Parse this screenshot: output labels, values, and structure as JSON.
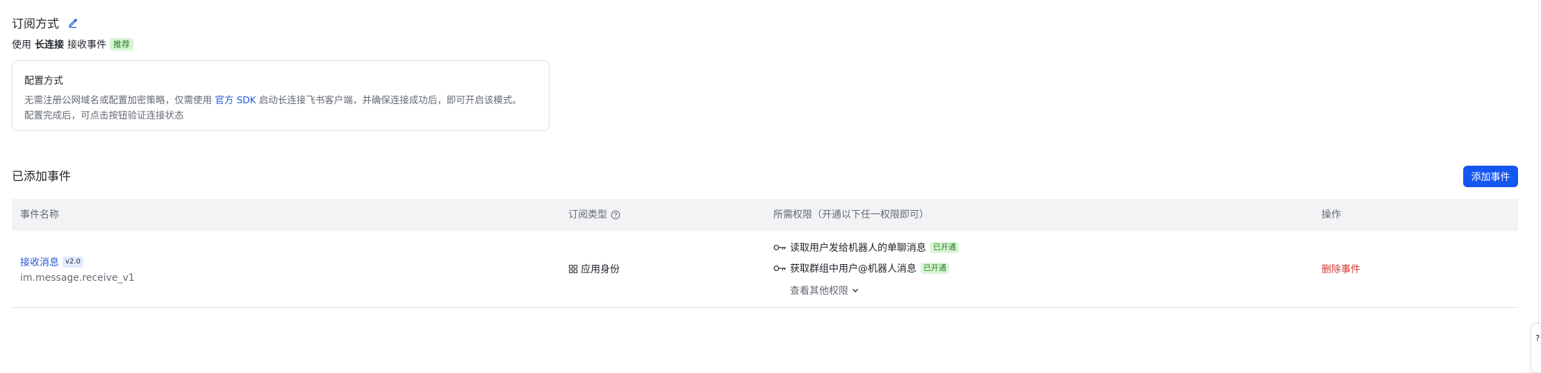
{
  "subscription": {
    "title": "订阅方式",
    "mode_prefix": "使用",
    "mode_bold": "长连接",
    "mode_suffix": "接收事件",
    "recommend_tag": "推荐"
  },
  "config": {
    "title": "配置方式",
    "desc_part1": "无需注册公网域名或配置加密策略，仅需使用 ",
    "desc_link": "官方 SDK",
    "desc_part2": " 启动长连接飞书客户端，并确保连接成功后，即可开启该模式。",
    "desc_line2": "配置完成后，可点击按钮验证连接状态"
  },
  "events": {
    "title": "已添加事件",
    "add_button": "添加事件",
    "columns": [
      "事件名称",
      "订阅类型",
      "所需权限（开通以下任一权限即可）",
      "操作"
    ],
    "rows": [
      {
        "name": "接收消息",
        "version": "v2.0",
        "key": "im.message.receive_v1",
        "type": "应用身份",
        "permissions": [
          {
            "text": "读取用户发给机器人的单聊消息",
            "status": "已开通"
          },
          {
            "text": "获取群组中用户@机器人消息",
            "status": "已开通"
          }
        ],
        "view_more": "查看其他权限",
        "action": "删除事件"
      }
    ]
  },
  "edge_widget": {
    "label": "?"
  },
  "colors": {
    "primary": "#1456f0",
    "link": "#245bdb",
    "danger": "#d83931",
    "success_bg": "#d9f5d6",
    "success_text": "#237b19"
  }
}
